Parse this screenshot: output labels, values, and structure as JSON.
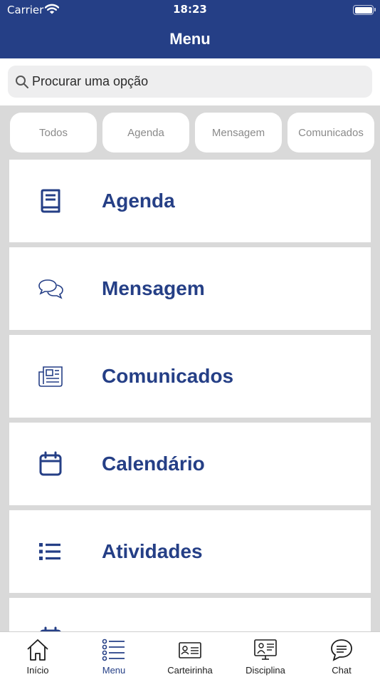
{
  "status": {
    "carrier": "Carrier",
    "time": "18:23"
  },
  "header": {
    "title": "Menu"
  },
  "search": {
    "placeholder": "Procurar uma opção"
  },
  "filters": [
    "Todos",
    "Agenda",
    "Mensagem",
    "Comunicados"
  ],
  "menu": {
    "items": [
      {
        "label": "Agenda",
        "icon": "book-icon"
      },
      {
        "label": "Mensagem",
        "icon": "chat-bubbles-icon"
      },
      {
        "label": "Comunicados",
        "icon": "newspaper-icon"
      },
      {
        "label": "Calendário",
        "icon": "calendar-icon"
      },
      {
        "label": "Atividades",
        "icon": "list-icon"
      }
    ]
  },
  "tabs": [
    {
      "label": "Início",
      "icon": "home-icon",
      "active": false
    },
    {
      "label": "Menu",
      "icon": "menu-list-icon",
      "active": true
    },
    {
      "label": "Carteirinha",
      "icon": "id-card-icon",
      "active": false
    },
    {
      "label": "Disciplina",
      "icon": "monitor-teacher-icon",
      "active": false
    },
    {
      "label": "Chat",
      "icon": "chat-icon",
      "active": false
    }
  ],
  "colors": {
    "primary": "#253f86",
    "background": "#d9d9d9",
    "card": "#ffffff"
  }
}
